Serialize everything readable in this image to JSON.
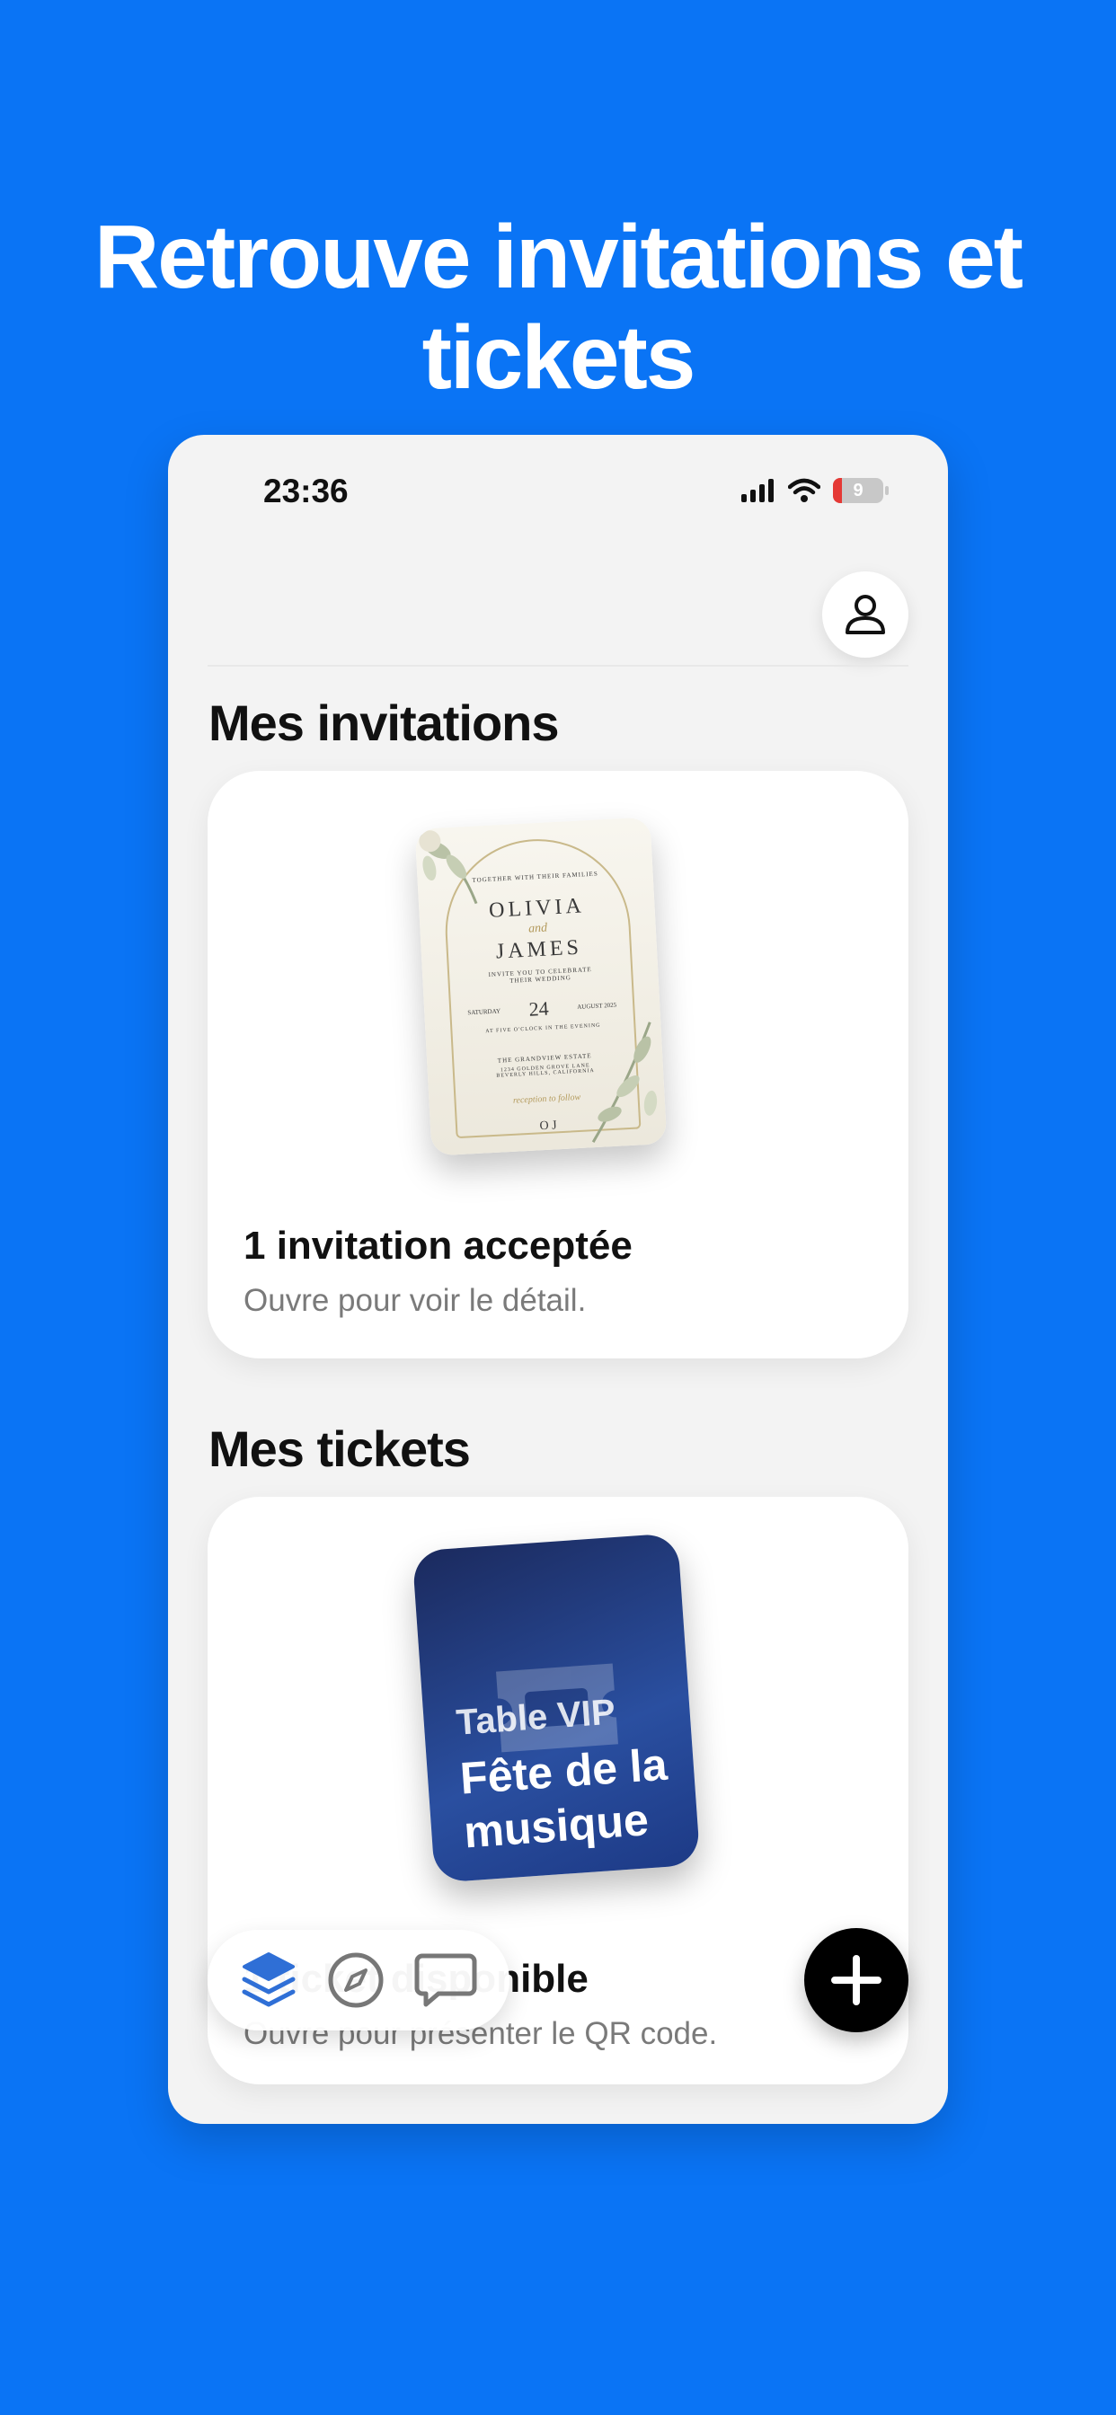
{
  "headline": "Retrouve invitations et tickets",
  "colors": {
    "background": "#0A74F5",
    "accent": "#2F6FD6"
  },
  "status_bar": {
    "time": "23:36",
    "battery": "9",
    "icons": [
      "signal-icon",
      "wifi-icon",
      "battery-icon"
    ]
  },
  "header": {
    "profile_icon": "person-icon"
  },
  "invitations": {
    "section_title": "Mes invitations",
    "card_title": "1 invitation acceptée",
    "card_subtitle": "Ouvre pour voir le détail.",
    "artwork": {
      "top_line": "TOGETHER WITH THEIR FAMILIES",
      "name1": "OLIVIA",
      "and": "and",
      "name2": "JAMES",
      "invite_line": "INVITE YOU TO CELEBRATE THEIR WEDDING",
      "day": "SATURDAY",
      "date": "24",
      "month": "AUGUST 2025",
      "time_line": "AT FIVE O'CLOCK IN THE EVENING",
      "venue": "THE GRANDVIEW ESTATE",
      "address": "1234 GOLDEN GROVE LANE BEVERLY HILLS, CALIFORNIA",
      "reception": "reception to follow",
      "monogram": "O J"
    }
  },
  "tickets": {
    "section_title": "Mes tickets",
    "card_title": "1 ticket disponible",
    "card_subtitle": "Ouvre pour présenter le QR code.",
    "ticket_subtitle": "Table VIP",
    "ticket_title": "Fête de la musique"
  },
  "tabbar": {
    "items": [
      "layers-icon",
      "compass-icon",
      "chat-icon"
    ],
    "active": "layers-icon"
  },
  "fab": {
    "icon": "plus-icon"
  }
}
